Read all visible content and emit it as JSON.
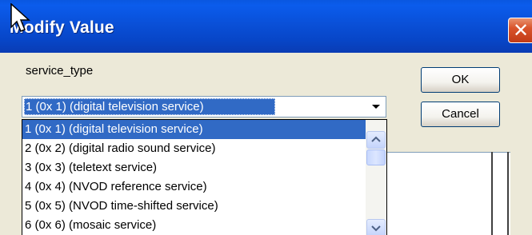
{
  "window": {
    "title": "Modify Value",
    "close_glyph": "✕"
  },
  "field": {
    "label": "service_type",
    "selected_value": "1 (0x 1) (digital television service)"
  },
  "buttons": {
    "ok_label": "OK",
    "cancel_label": "Cancel"
  },
  "dropdown": {
    "items": [
      {
        "label": "1 (0x 1) (digital television service)",
        "selected": true
      },
      {
        "label": "2 (0x 2) (digital radio sound service)",
        "selected": false
      },
      {
        "label": "3 (0x 3) (teletext service)",
        "selected": false
      },
      {
        "label": "4 (0x 4) (NVOD reference service)",
        "selected": false
      },
      {
        "label": "5 (0x 5) (NVOD time-shifted service)",
        "selected": false
      },
      {
        "label": "6 (0x 6) (mosaic service)",
        "selected": false
      }
    ]
  },
  "colors": {
    "titlebar": "#0a50d8",
    "selection": "#316ac5",
    "close_button": "#d9542b",
    "dialog_bg": "#ece9d8"
  },
  "icons": [
    "mouse-cursor-icon",
    "close-icon",
    "chevron-down-icon",
    "scroll-up-icon",
    "scroll-down-icon"
  ]
}
